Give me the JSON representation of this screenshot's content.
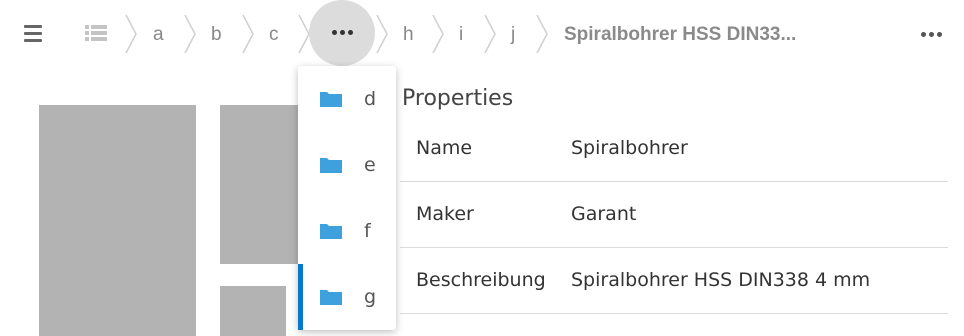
{
  "topbar": {
    "menu_icon": "hamburger-icon",
    "list_icon": "list-view-icon",
    "breadcrumbs": [
      "a",
      "b",
      "c",
      "h",
      "i",
      "j"
    ],
    "current": "Spiralbohrer HSS DIN33...",
    "overflow_icon": "more-horizontal-icon",
    "actions_icon": "more-horizontal-icon"
  },
  "dropdown": {
    "items": [
      {
        "label": "d",
        "icon": "folder-icon"
      },
      {
        "label": "e",
        "icon": "folder-icon"
      },
      {
        "label": "f",
        "icon": "folder-icon"
      },
      {
        "label": "g",
        "icon": "folder-icon",
        "selected": true
      }
    ]
  },
  "properties": {
    "title": "Properties",
    "rows": [
      {
        "key": "Name",
        "value": "Spiralbohrer"
      },
      {
        "key": "Maker",
        "value": "Garant"
      },
      {
        "key": "Beschreibung",
        "value": "Spiralbohrer HSS DIN338 4 mm"
      }
    ]
  },
  "colors": {
    "accent": "#0a78c8",
    "folder": "#3ea0dc",
    "thumbnail": "#b3b3b3",
    "overflow_bg": "#dcdcdc"
  }
}
